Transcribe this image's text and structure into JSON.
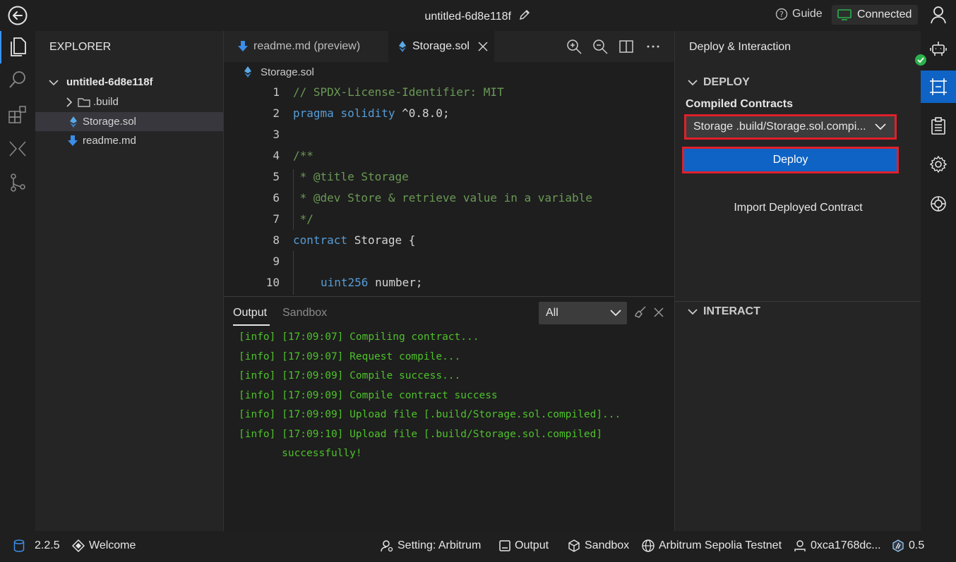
{
  "titlebar": {
    "title": "untitled-6d8e118f",
    "guide_label": "Guide",
    "connection_label": "Connected"
  },
  "explorer": {
    "title": "EXPLORER",
    "project": "untitled-6d8e118f",
    "items": [
      {
        "label": ".build",
        "type": "folder"
      },
      {
        "label": "Storage.sol",
        "type": "file"
      },
      {
        "label": "readme.md",
        "type": "file"
      }
    ]
  },
  "editor": {
    "tabs": [
      {
        "label": "readme.md (preview)"
      },
      {
        "label": "Storage.sol"
      }
    ],
    "breadcrumb": "Storage.sol",
    "lines": [
      {
        "n": "1",
        "text": "// SPDX-License-Identifier: MIT"
      },
      {
        "n": "2",
        "kw": "pragma",
        "kw2": "solidity",
        "rest": "^0.8.0;"
      },
      {
        "n": "3"
      },
      {
        "n": "4",
        "text": "/**"
      },
      {
        "n": "5",
        "text": " * @title Storage"
      },
      {
        "n": "6",
        "text": " * @dev Store & retrieve value in a variable"
      },
      {
        "n": "7",
        "text": " */"
      },
      {
        "n": "8",
        "kw": "contract",
        "rest": "Storage {"
      },
      {
        "n": "9"
      },
      {
        "n": "10",
        "kw": "uint256",
        "rest": "number;"
      }
    ]
  },
  "panel": {
    "tabs": [
      "Output",
      "Sandbox"
    ],
    "filter_value": "All",
    "logs": [
      "[info] [17:09:07] Compiling contract...",
      "[info] [17:09:07] Request compile...",
      "[info] [17:09:09] Compile success...",
      "[info] [17:09:09] Compile contract success",
      "[info] [17:09:09] Upload file [.build/Storage.sol.compiled]...",
      "[info] [17:09:10] Upload file [.build/Storage.sol.compiled]",
      "       successfully!"
    ]
  },
  "deploy": {
    "title": "Deploy & Interaction",
    "deploy_section": "DEPLOY",
    "compiled_label": "Compiled Contracts",
    "selected_contract": "Storage .build/Storage.sol.compi...",
    "deploy_button": "Deploy",
    "import_link": "Import Deployed Contract",
    "interact_section": "INTERACT"
  },
  "statusbar": {
    "version": "2.2.5",
    "welcome": "Welcome",
    "setting": "Setting: Arbitrum",
    "output": "Output",
    "sandbox": "Sandbox",
    "network": "Arbitrum Sepolia Testnet",
    "account": "0xca1768dc...",
    "balance": "0.5"
  },
  "colors": {
    "accent": "#0e63c4",
    "highlight_border": "#e0202a",
    "log_green": "#4ec12b",
    "connected_green": "#2bb24c"
  }
}
